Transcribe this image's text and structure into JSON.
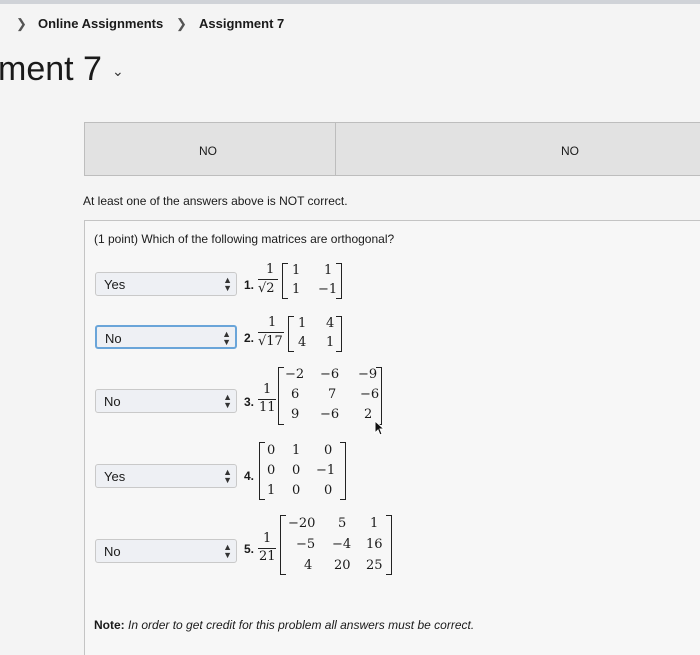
{
  "breadcrumb": {
    "items": [
      {
        "label": "Online Assignments"
      },
      {
        "label": "Assignment 7"
      }
    ]
  },
  "page": {
    "title": "ment 7"
  },
  "previous_answers": [
    "NO",
    "NO"
  ],
  "status_message": "At least one of the answers above is NOT correct.",
  "question": {
    "text": "(1 point) Which of the following matrices are orthogonal?",
    "items": [
      {
        "number": "1.",
        "answer": "Yes",
        "coef_num": "1",
        "coef_den": "√2",
        "matrix": [
          [
            "1",
            "1"
          ],
          [
            "1",
            "−1"
          ]
        ]
      },
      {
        "number": "2.",
        "answer": "No",
        "coef_num": "1",
        "coef_den": "√17",
        "matrix": [
          [
            "1",
            "4"
          ],
          [
            "4",
            "1"
          ]
        ]
      },
      {
        "number": "3.",
        "answer": "No",
        "coef_num": "1",
        "coef_den": "11",
        "matrix": [
          [
            "−2",
            "−6",
            "−9"
          ],
          [
            "6",
            "7",
            "−6"
          ],
          [
            "9",
            "−6",
            "2"
          ]
        ]
      },
      {
        "number": "4.",
        "answer": "Yes",
        "matrix": [
          [
            "0",
            "1",
            "0"
          ],
          [
            "0",
            "0",
            "−1"
          ],
          [
            "1",
            "0",
            "0"
          ]
        ]
      },
      {
        "number": "5.",
        "answer": "No",
        "coef_num": "1",
        "coef_den": "21",
        "matrix": [
          [
            "−20",
            "5",
            "1"
          ],
          [
            "−5",
            "−4",
            "16"
          ],
          [
            "4",
            "20",
            "25"
          ]
        ]
      }
    ]
  },
  "note": {
    "label": "Note:",
    "text": "In order to get credit for this problem all answers must be correct."
  }
}
